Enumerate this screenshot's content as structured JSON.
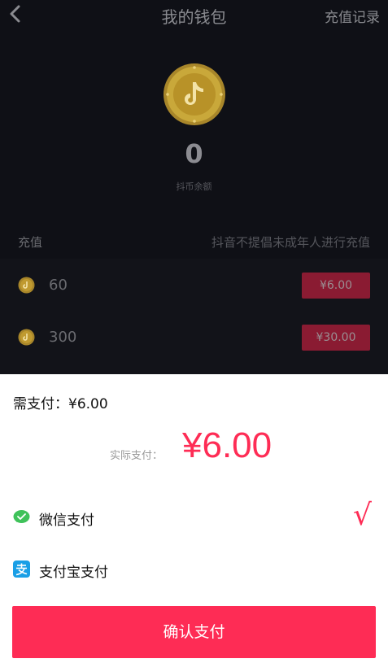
{
  "header": {
    "title": "我的钱包",
    "records_label": "充值记录",
    "back_icon": "chevron-left-icon"
  },
  "wallet": {
    "coin_icon": "douyin-coin-icon",
    "balance": "0",
    "balance_label": "抖币余额"
  },
  "recharge": {
    "title": "充值",
    "notice": "抖音不提倡未成年人进行充值",
    "options": [
      {
        "coins": "60",
        "price": "¥6.00"
      },
      {
        "coins": "300",
        "price": "¥30.00"
      }
    ]
  },
  "payment": {
    "need_pay": "需支付：¥6.00",
    "actual_label": "实际支付：",
    "actual_amount": "¥6.00",
    "methods": [
      {
        "label": "微信支付",
        "icon": "wechat-pay-icon",
        "selected": true
      },
      {
        "label": "支付宝支付",
        "icon": "alipay-icon",
        "selected": false
      }
    ],
    "selected_mark": "√",
    "confirm_label": "确认支付"
  },
  "colors": {
    "accent": "#fe2c55",
    "overlay_bg": "#0f1016",
    "wechat": "#3fc25a",
    "alipay": "#1a9fe6",
    "coin_gold": "#e6b422"
  }
}
